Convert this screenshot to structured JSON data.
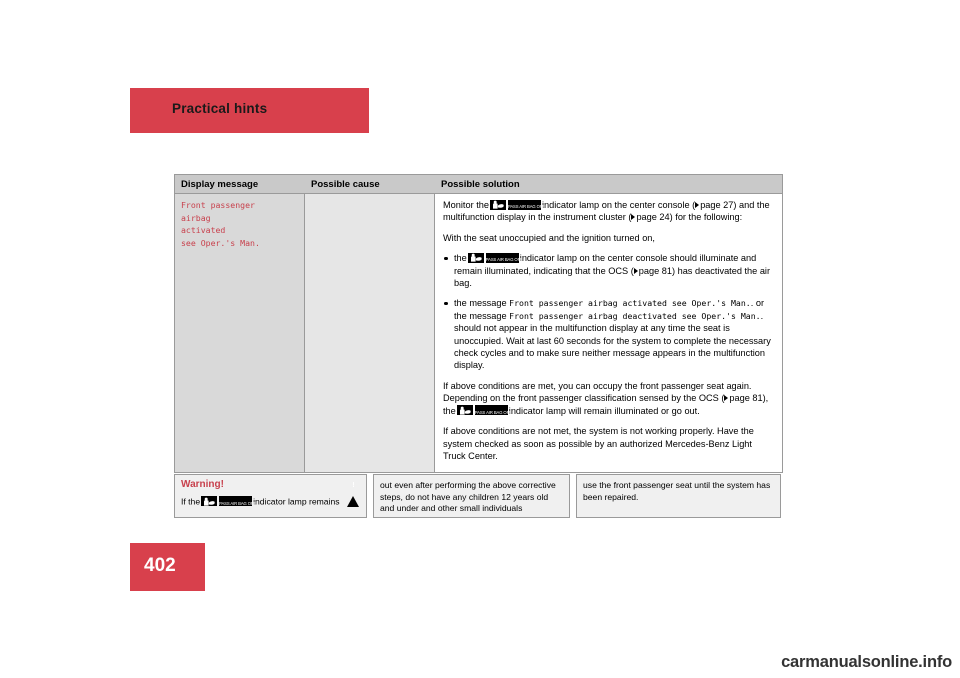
{
  "header": {
    "title": "Practical hints"
  },
  "page": {
    "number": "402"
  },
  "table": {
    "columns": [
      "Display message",
      "Possible cause",
      "Possible solution"
    ],
    "row": {
      "display_message": "Front passenger\nairbag\nactivated\nsee Oper.'s Man.",
      "possible_cause": "",
      "solution": {
        "intro_1a": "Monitor the",
        "intro_1b": "indicator lamp on the center console (",
        "intro_1c": "page 27) and the multifunction display in the instrument cluster (",
        "intro_1d": "page 24) for the following:",
        "intro_2": "With the seat unoccupied and the ignition turned on,",
        "bullet1_a": "the",
        "bullet1_b": "indicator lamp on the center console should illuminate and remain illuminated, indicating that the OCS (",
        "bullet1_c": "page 81) has deactivated the air bag.",
        "bullet2_a": "the message",
        "bullet2_mono1": "Front passenger airbag activated see Oper.'s Man.",
        "bullet2_b": "or the message",
        "bullet2_mono2": "Front passenger airbag deactivated see Oper.'s Man.",
        "bullet2_c": "should not appear in the multifunction display at any time the seat is unoccupied. Wait at last 60 seconds for the system to complete the necessary check cycles and to make sure neither message appears in the multifunction display.",
        "para3_a": "If above conditions are met, you can occupy the front passenger seat again. Depending on the front passenger classification sensed by the OCS (",
        "para3_b": "page 81), the",
        "para3_c": "indicator lamp will remain illuminated or go out.",
        "para4": "If above conditions are not met, the system is not working properly. Have the system checked as soon as possible by an authorized Mercedes-Benz Light Truck Center."
      }
    }
  },
  "warning": {
    "title": "Warning!",
    "triangle_symbol": "!",
    "box1_text_a": "If the",
    "box1_text_b": "indicator lamp remains",
    "box2_text": "out even after performing the above corrective steps, do not have any children 12 years old and under and other small individuals",
    "box3_text": "use the front passenger seat until the system has been repaired."
  },
  "icons": {
    "airbag_icon": "passenger-airbag-symbol",
    "off_label": "PASS AIR BAG",
    "off_label2": "OFF",
    "page_ref_arrow": "triangle-right"
  },
  "watermark": {
    "text": "carmanualsonline.info"
  }
}
